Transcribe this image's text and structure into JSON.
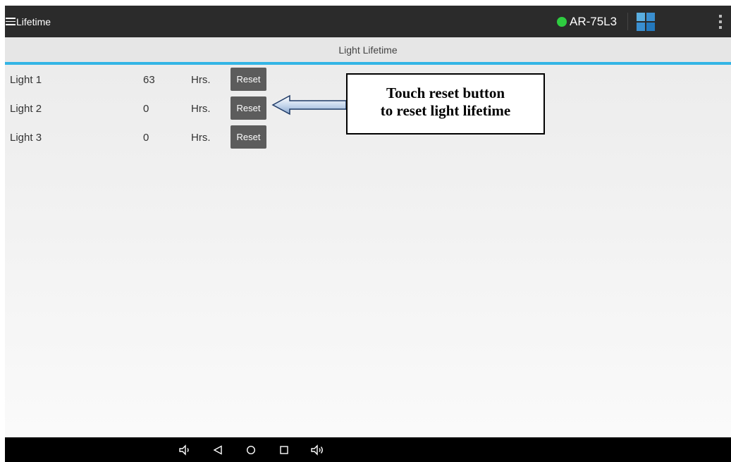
{
  "header": {
    "menu_label": "Lifetime",
    "device_name": "AR-75L3",
    "status_color": "#2ecc40"
  },
  "section": {
    "title": "Light Lifetime"
  },
  "lights": [
    {
      "name": "Light 1",
      "hours": "63",
      "unit": "Hrs.",
      "button": "Reset"
    },
    {
      "name": "Light 2",
      "hours": "0",
      "unit": "Hrs.",
      "button": "Reset"
    },
    {
      "name": "Light 3",
      "hours": "0",
      "unit": "Hrs.",
      "button": "Reset"
    }
  ],
  "callout": {
    "line1": "Touch reset button",
    "line2": "to reset light lifetime"
  },
  "nav_icons": [
    "volume-down-icon",
    "back-icon",
    "home-icon",
    "recents-icon",
    "volume-up-icon"
  ],
  "accent_color": "#33b5e5"
}
